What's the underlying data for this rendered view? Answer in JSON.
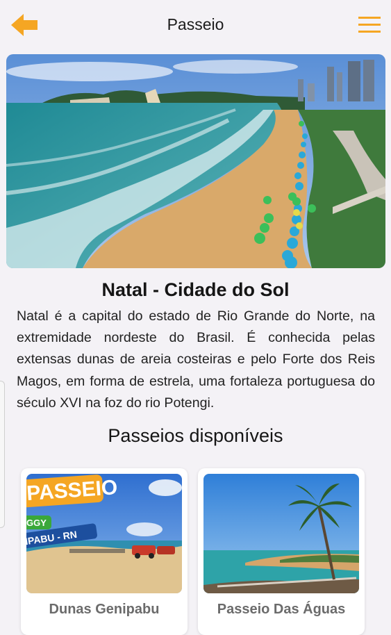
{
  "header": {
    "title": "Passeio",
    "back_icon": "arrow-left-icon",
    "menu_icon": "hamburger-menu-icon",
    "accent_color": "#f5a623"
  },
  "destination": {
    "title": "Natal - Cidade do Sol",
    "description": "Natal é a capital do estado de Rio Grande do Norte, na extremidade nordeste do Brasil. É conhecida pelas extensas dunas de areia costeiras e pelo Forte dos Reis Magos, em forma de estrela, uma fortaleza portuguesa do século XVI na foz do rio Potengi."
  },
  "tours": {
    "section_title": "Passeios disponíveis",
    "items": [
      {
        "name": "Dunas Genipabu",
        "image_banner": "PASSEIO",
        "image_tag": "GGY",
        "image_place": "IPABU - RN"
      },
      {
        "name": "Passeio Das Águas"
      }
    ]
  }
}
